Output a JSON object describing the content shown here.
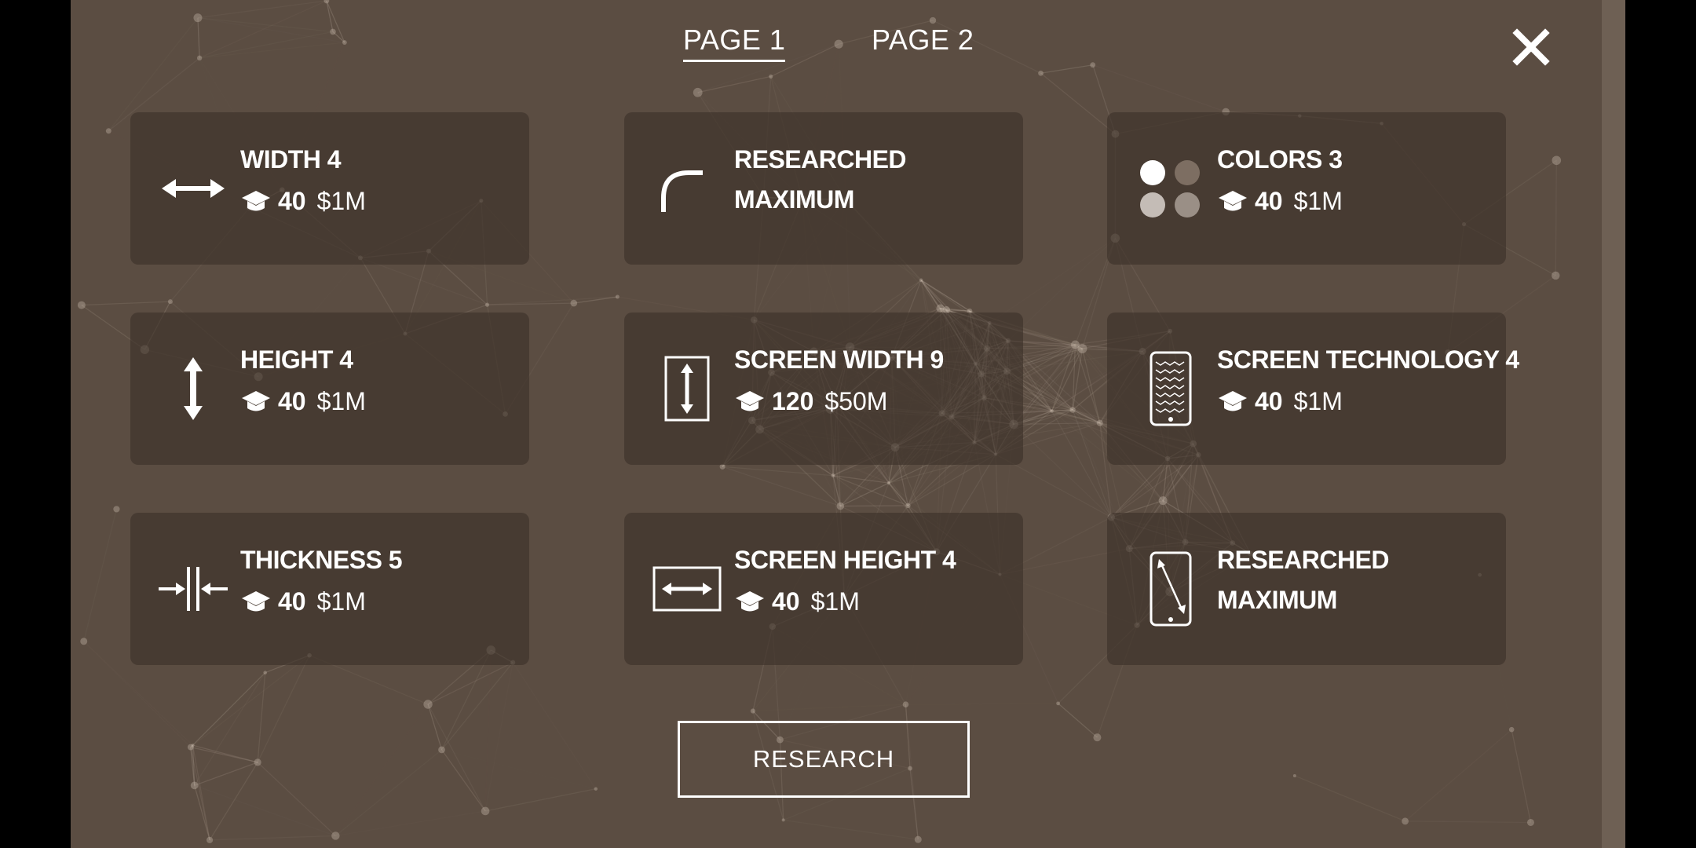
{
  "tabs": [
    "PAGE 1",
    "PAGE 2"
  ],
  "cards": [
    {
      "title": "WIDTH 4",
      "research": "40",
      "price": "$1M",
      "icon": "horizontal-arrows-icon"
    },
    {
      "title": "RESEARCHED",
      "title2": "MAXIMUM",
      "icon": "corner-radius-icon"
    },
    {
      "title": "COLORS 3",
      "research": "40",
      "price": "$1M",
      "icon": "color-dots-icon"
    },
    {
      "title": "HEIGHT 4",
      "research": "40",
      "price": "$1M",
      "icon": "vertical-arrows-icon"
    },
    {
      "title": "SCREEN WIDTH 9",
      "research": "120",
      "price": "$50M",
      "icon": "screen-width-icon"
    },
    {
      "title": "SCREEN TECHNOLOGY 4",
      "research": "40",
      "price": "$1M",
      "icon": "screen-technology-icon"
    },
    {
      "title": "THICKNESS 5",
      "research": "40",
      "price": "$1M",
      "icon": "thickness-icon"
    },
    {
      "title": "SCREEN HEIGHT 4",
      "research": "40",
      "price": "$1M",
      "icon": "screen-height-icon"
    },
    {
      "title": "RESEARCHED",
      "title2": "MAXIMUM",
      "icon": "hd-resolution-icon"
    }
  ],
  "research_button": "RESEARCH",
  "colors": {
    "panel": "#5b4d42",
    "card": "#3c3028",
    "text": "#ffffff"
  }
}
